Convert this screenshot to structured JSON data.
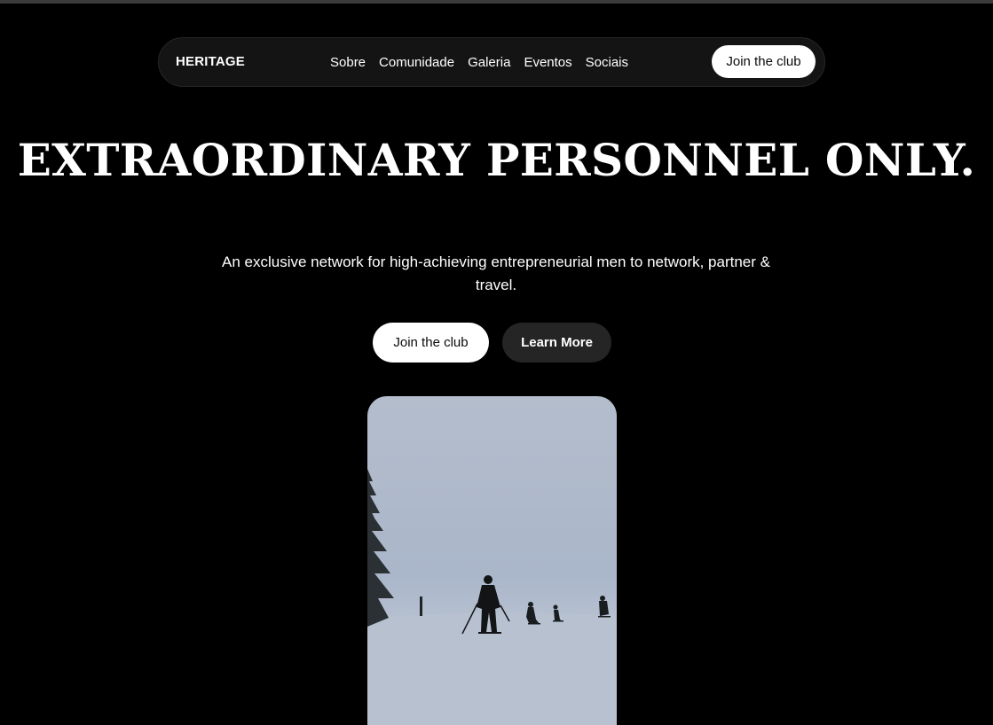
{
  "nav": {
    "brand": "HERITAGE",
    "links": [
      "Sobre",
      "Comunidade",
      "Galeria",
      "Eventos",
      "Sociais"
    ],
    "cta": "Join the club"
  },
  "hero": {
    "title": "EXTRAORDINARY PERSONNEL ONLY.",
    "subtitle": "An exclusive network for high-achieving entrepreneurial men to network, partner & travel.",
    "primary_button": "Join the club",
    "secondary_button": "Learn More"
  },
  "colors": {
    "background": "#000000",
    "nav_background": "#141414",
    "primary_button": "#ffffff",
    "secondary_button": "#252525"
  }
}
